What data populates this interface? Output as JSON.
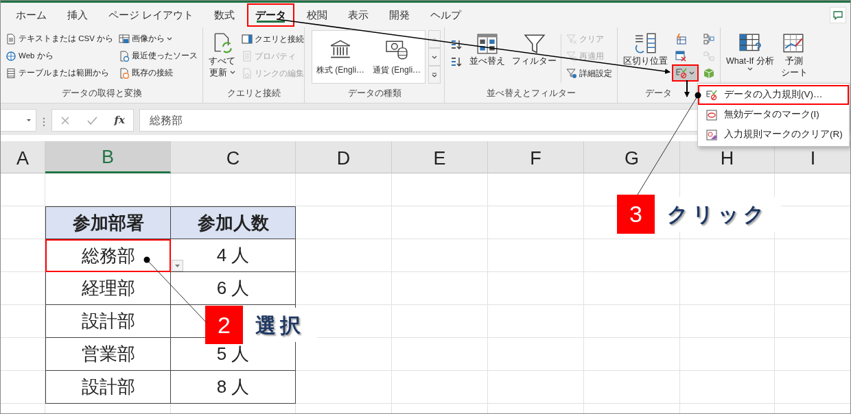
{
  "tabs": [
    {
      "label": "ホーム",
      "selected": false,
      "highlighted": false
    },
    {
      "label": "挿入",
      "selected": false,
      "highlighted": false
    },
    {
      "label": "ページ レイアウト",
      "selected": false,
      "highlighted": false
    },
    {
      "label": "数式",
      "selected": false,
      "highlighted": false
    },
    {
      "label": "データ",
      "selected": true,
      "highlighted": true
    },
    {
      "label": "校閲",
      "selected": false,
      "highlighted": false
    },
    {
      "label": "表示",
      "selected": false,
      "highlighted": false
    },
    {
      "label": "開発",
      "selected": false,
      "highlighted": false
    },
    {
      "label": "ヘルプ",
      "selected": false,
      "highlighted": false
    }
  ],
  "ribbon": {
    "groups": [
      {
        "label": "データの取得と変換",
        "columns": [
          [
            {
              "kind": "small",
              "label": "テキストまたは CSV から",
              "disabled": false
            },
            {
              "kind": "small",
              "label": "Web から",
              "disabled": false
            },
            {
              "kind": "small",
              "label": "テーブルまたは範囲から",
              "disabled": false
            }
          ],
          [
            {
              "kind": "small",
              "label": "画像から",
              "disabled": false,
              "has_menu": true
            },
            {
              "kind": "small",
              "label": "最近使ったソース",
              "disabled": false
            },
            {
              "kind": "small",
              "label": "既存の接続",
              "disabled": false
            }
          ]
        ]
      },
      {
        "label": "クエリと接続",
        "columns": [
          [
            {
              "kind": "large",
              "lines": [
                "すべて",
                "更新"
              ],
              "disabled": false,
              "has_menu": true
            }
          ],
          [
            {
              "kind": "small",
              "label": "クエリと接続",
              "disabled": false
            },
            {
              "kind": "small",
              "label": "プロパティ",
              "disabled": true
            },
            {
              "kind": "small",
              "label": "リンクの編集",
              "disabled": true
            }
          ]
        ]
      },
      {
        "label": "データの種類",
        "columns": [
          [
            {
              "kind": "gallery",
              "options": [
                "株式 (Engli…",
                "通貨 (Engli…"
              ]
            }
          ]
        ]
      },
      {
        "label": "並べ替えとフィルター",
        "columns": [
          [
            {
              "kind": "icon",
              "disabled": false
            },
            {
              "kind": "icon",
              "disabled": false
            }
          ],
          [
            {
              "kind": "large",
              "label": "並べ替え",
              "disabled": false
            }
          ],
          [
            {
              "kind": "large",
              "label": "フィルター",
              "disabled": false
            }
          ],
          [
            {
              "kind": "small",
              "label": "クリア",
              "disabled": true
            },
            {
              "kind": "small",
              "label": "再適用",
              "disabled": true
            },
            {
              "kind": "small",
              "label": "詳細設定",
              "disabled": false
            }
          ]
        ]
      },
      {
        "label": "データ",
        "columns": [
          [
            {
              "kind": "large",
              "label": "区切り位置",
              "disabled": false
            }
          ],
          [
            {
              "kind": "icon",
              "disabled": false,
              "pressed": false,
              "highlighted": false
            },
            {
              "kind": "icon",
              "disabled": false,
              "pressed": false,
              "highlighted": false
            },
            {
              "kind": "icon",
              "disabled": false,
              "has_menu": true,
              "pressed": true,
              "highlighted": true
            }
          ],
          [
            {
              "kind": "icon",
              "disabled": false
            },
            {
              "kind": "icon",
              "disabled": true
            },
            {
              "kind": "icon",
              "disabled": false
            }
          ]
        ]
      },
      {
        "columns": [
          [
            {
              "kind": "large",
              "label": "What-If 分析",
              "disabled": false,
              "has_menu": true
            }
          ],
          [
            {
              "kind": "large",
              "lines": [
                "予測",
                "シート"
              ],
              "disabled": false
            }
          ]
        ]
      }
    ]
  },
  "menu": {
    "items": [
      {
        "label": "データの入力規則(V)…",
        "highlighted": true
      },
      {
        "label": "無効データのマーク(I)",
        "highlighted": false
      },
      {
        "label": "入力規則マークのクリア(R)",
        "highlighted": false
      }
    ]
  },
  "formula_bar": {
    "function_label": "fx",
    "value": "総務部"
  },
  "sheet": {
    "columns": [
      {
        "label": "A",
        "selected": false
      },
      {
        "label": "B",
        "selected": true
      },
      {
        "label": "C",
        "selected": false
      },
      {
        "label": "D",
        "selected": false
      },
      {
        "label": "E",
        "selected": false
      },
      {
        "label": "F",
        "selected": false
      },
      {
        "label": "G",
        "selected": false
      },
      {
        "label": "H",
        "selected": false
      },
      {
        "label": "I",
        "selected": false
      }
    ],
    "table": {
      "headers": [
        "参加部署",
        "参加人数"
      ],
      "rows": [
        {
          "department": "総務部",
          "count": "4 人",
          "selected": true,
          "has_list": true
        },
        {
          "department": "経理部",
          "count": "6 人",
          "selected": false
        },
        {
          "department": "設計部",
          "selected": false
        },
        {
          "department": "営業部",
          "count": "5 人",
          "selected": false
        },
        {
          "department": "設計部",
          "count": "8 人",
          "selected": false
        }
      ]
    }
  },
  "callouts": [
    {
      "number": "2",
      "label": "選択"
    },
    {
      "number": "3",
      "label": "クリック"
    }
  ]
}
